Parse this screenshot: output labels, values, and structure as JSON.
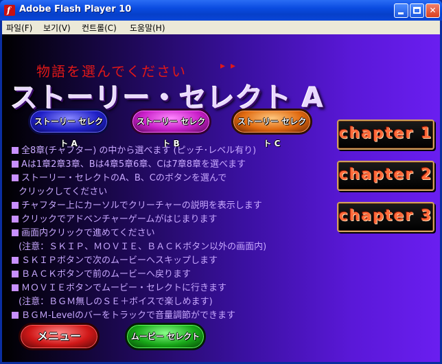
{
  "window": {
    "title": "Adobe Flash Player 10",
    "app_icon_glyph": "f",
    "minimize_glyph": "",
    "close_glyph": "✕"
  },
  "menubar": {
    "items": [
      "파일(F)",
      "보기(V)",
      "컨트롤(C)",
      "도움말(H)"
    ]
  },
  "stage": {
    "subtitle": "物語を選んでください",
    "subtitle_arrows": "▸▸",
    "title": "ストーリー・セレクト A",
    "story_buttons": [
      "ストーリー セレクト A",
      "ストーリー セレクト B",
      "ストーリー セレクト C"
    ],
    "chapter_buttons": [
      "chapter 1",
      "chapter 2",
      "chapter 3"
    ],
    "instructions": [
      {
        "bullet": true,
        "text": "全8章(チャフター) の中から選べます (ピッチ･レベル有り)"
      },
      {
        "bullet": true,
        "text": "Aは1章2章3章、Bは4章5章6章、Cは7章8章を選べます"
      },
      {
        "bullet": true,
        "text": "ストーリー・セレクトのA、B、Cのボタンを選んで"
      },
      {
        "bullet": false,
        "text": "クリックしてください"
      },
      {
        "bullet": true,
        "text": "チャフター上にカーソルでクリーチャーの説明を表示します"
      },
      {
        "bullet": true,
        "text": "クリックでアドベンチャーゲームがはじまります"
      },
      {
        "bullet": true,
        "text": "画面内クリックで進めてください"
      },
      {
        "bullet": false,
        "text": "(注意：ＳＫＩＰ、ＭＯＶＩＥ、ＢＡＣＫボタン以外の画面内)"
      },
      {
        "bullet": true,
        "text": "ＳＫＩＰボタンで次のムービーへスキップします"
      },
      {
        "bullet": true,
        "text": "ＢＡＣＫボタンで前のムービーへ戻ります"
      },
      {
        "bullet": true,
        "text": "ＭＯＶＩＥボタンでムービー・セレクトに行きます"
      },
      {
        "bullet": false,
        "text": "(注意：ＢＧＭ無しのＳＥ＋ボイスで楽しめます)"
      },
      {
        "bullet": true,
        "text": "ＢＧＭ-Levelのバーをトラックで音量調節ができます"
      }
    ],
    "menu_button": "メニュー",
    "movie_select_button": "ムービー セレクト"
  },
  "colors": {
    "titlebar": "#0a4be0",
    "subtitle": "#e01818",
    "instruction_text": "#c8a8ff",
    "chapter_text": "#ff6a3a"
  }
}
